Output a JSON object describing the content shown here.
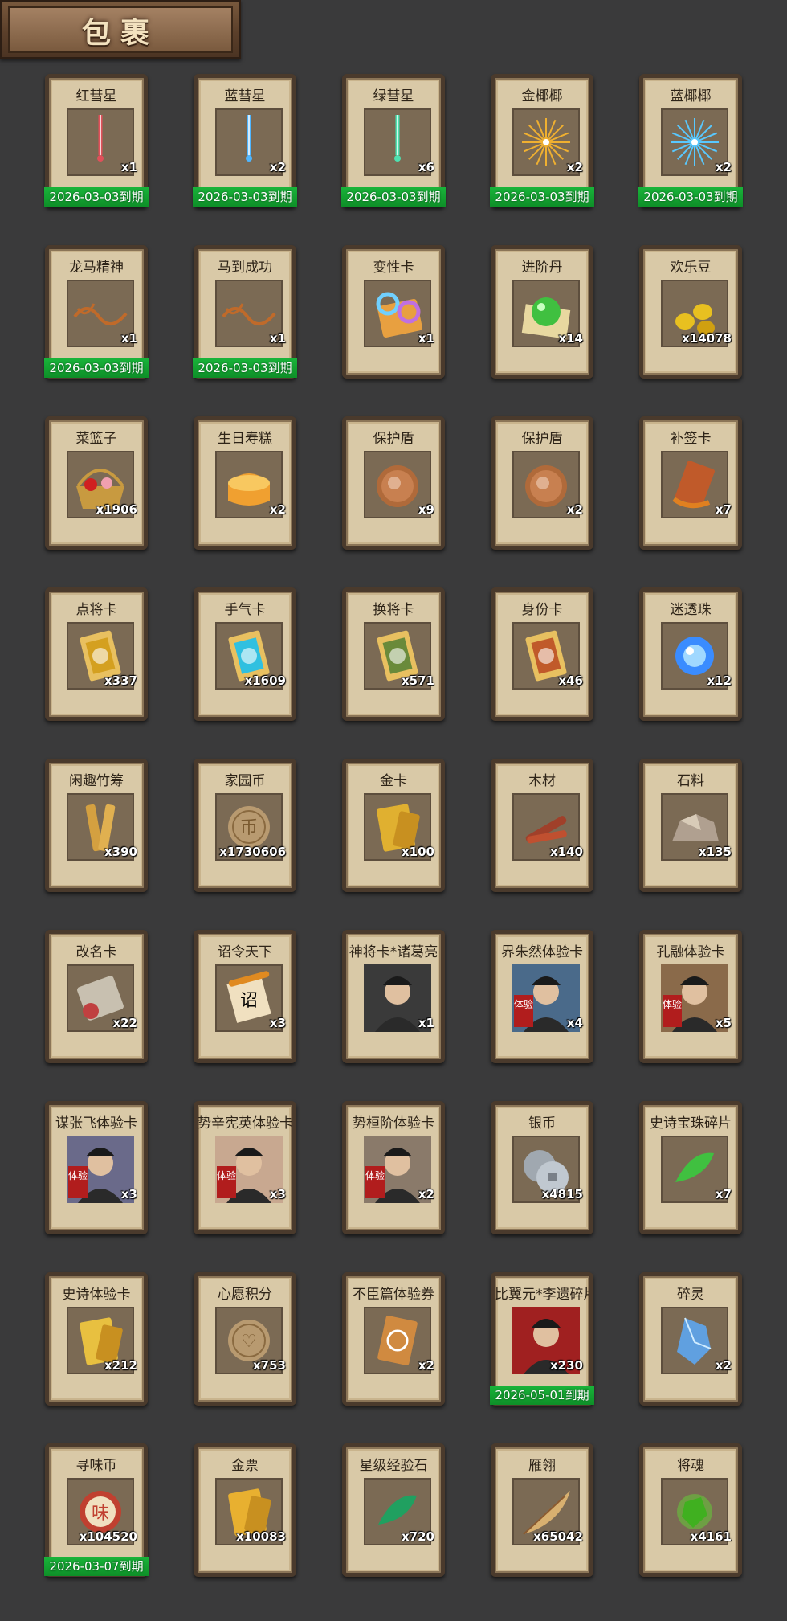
{
  "header": {
    "title": "包裹"
  },
  "items": [
    {
      "name": "红彗星",
      "qty": "x1",
      "expiry": "2026-03-03到期",
      "icon": "red-comet-icon",
      "color": "#e0505a"
    },
    {
      "name": "蓝彗星",
      "qty": "x2",
      "expiry": "2026-03-03到期",
      "icon": "blue-comet-icon",
      "color": "#4fb6ff"
    },
    {
      "name": "绿彗星",
      "qty": "x6",
      "expiry": "2026-03-03到期",
      "icon": "green-comet-icon",
      "color": "#4ee0b0"
    },
    {
      "name": "金椰椰",
      "qty": "x2",
      "expiry": "2026-03-03到期",
      "icon": "gold-firework-icon",
      "color": "#f0b030"
    },
    {
      "name": "蓝椰椰",
      "qty": "x2",
      "expiry": "2026-03-03到期",
      "icon": "blue-firework-icon",
      "color": "#58c8ff"
    },
    {
      "name": "龙马精神",
      "qty": "x1",
      "expiry": "2026-03-03到期",
      "icon": "calligraphy-icon",
      "color": "#c06a2a"
    },
    {
      "name": "马到成功",
      "qty": "x1",
      "expiry": "2026-03-03到期",
      "icon": "calligraphy-icon",
      "color": "#c06a2a"
    },
    {
      "name": "变性卡",
      "qty": "x1",
      "expiry": "",
      "icon": "gender-card-icon",
      "color": "#c070e0"
    },
    {
      "name": "进阶丹",
      "qty": "x14",
      "expiry": "",
      "icon": "green-pill-icon",
      "color": "#40c040"
    },
    {
      "name": "欢乐豆",
      "qty": "x14078",
      "expiry": "",
      "icon": "gold-beans-icon",
      "color": "#e8c020"
    },
    {
      "name": "菜篮子",
      "qty": "x1906",
      "expiry": "",
      "icon": "basket-icon",
      "color": "#c89a40"
    },
    {
      "name": "生日寿糕",
      "qty": "x2",
      "expiry": "",
      "icon": "cake-icon",
      "color": "#f0a030"
    },
    {
      "name": "保护盾",
      "qty": "x9",
      "expiry": "",
      "icon": "shield-icon",
      "color": "#b06a3a"
    },
    {
      "name": "保护盾",
      "qty": "x2",
      "expiry": "",
      "icon": "shield-icon",
      "color": "#b06a3a"
    },
    {
      "name": "补签卡",
      "qty": "x7",
      "expiry": "",
      "icon": "signin-card-icon",
      "color": "#c05a2a"
    },
    {
      "name": "点将卡",
      "qty": "x337",
      "expiry": "",
      "icon": "general-card-icon",
      "color": "#d4a020"
    },
    {
      "name": "手气卡",
      "qty": "x1609",
      "expiry": "",
      "icon": "luck-card-icon",
      "color": "#30c0e0"
    },
    {
      "name": "换将卡",
      "qty": "x571",
      "expiry": "",
      "icon": "swap-card-icon",
      "color": "#6a8a3a"
    },
    {
      "name": "身份卡",
      "qty": "x46",
      "expiry": "",
      "icon": "mask-card-icon",
      "color": "#c05a2a"
    },
    {
      "name": "迷透珠",
      "qty": "x12",
      "expiry": "",
      "icon": "blue-orb-icon",
      "color": "#3a8cff"
    },
    {
      "name": "闲趣竹筹",
      "qty": "x390",
      "expiry": "",
      "icon": "bamboo-token-icon",
      "color": "#d4a040"
    },
    {
      "name": "家园币",
      "qty": "x1730606",
      "expiry": "",
      "icon": "coin-icon",
      "color": "#b89a70"
    },
    {
      "name": "金卡",
      "qty": "x100",
      "expiry": "",
      "icon": "gold-card-icon",
      "color": "#e0b030"
    },
    {
      "name": "木材",
      "qty": "x140",
      "expiry": "",
      "icon": "wood-icon",
      "color": "#a0402a"
    },
    {
      "name": "石料",
      "qty": "x135",
      "expiry": "",
      "icon": "stone-icon",
      "color": "#b0a090"
    },
    {
      "name": "改名卡",
      "qty": "x22",
      "expiry": "",
      "icon": "rename-card-icon",
      "color": "#c04040"
    },
    {
      "name": "诏令天下",
      "qty": "x3",
      "expiry": "",
      "icon": "scroll-icon",
      "color": "#e08a20"
    },
    {
      "name": "神将卡*诸葛亮",
      "qty": "x1",
      "expiry": "",
      "icon": "portrait-icon",
      "color": "#3a3a3a"
    },
    {
      "name": "界朱然体验卡",
      "qty": "x4",
      "expiry": "",
      "icon": "portrait-icon",
      "color": "#4a6a8a",
      "tag": "体验"
    },
    {
      "name": "孔融体验卡",
      "qty": "x5",
      "expiry": "",
      "icon": "portrait-icon",
      "color": "#8a6a4a",
      "tag": "体验"
    },
    {
      "name": "谋张飞体验卡",
      "qty": "x3",
      "expiry": "",
      "icon": "portrait-icon",
      "color": "#6a6a8a",
      "tag": "体验"
    },
    {
      "name": "势辛宪英体验卡",
      "qty": "x3",
      "expiry": "",
      "icon": "portrait-icon",
      "color": "#c8a890",
      "tag": "体验"
    },
    {
      "name": "势桓阶体验卡",
      "qty": "x2",
      "expiry": "",
      "icon": "portrait-icon",
      "color": "#8a7a6a",
      "tag": "体验"
    },
    {
      "name": "银币",
      "qty": "x4815",
      "expiry": "",
      "icon": "silver-coin-icon",
      "color": "#a0a8b0"
    },
    {
      "name": "史诗宝珠碎片",
      "qty": "x7",
      "expiry": "",
      "icon": "green-shard-icon",
      "color": "#40c040"
    },
    {
      "name": "史诗体验卡",
      "qty": "x212",
      "expiry": "",
      "icon": "gold-card-icon",
      "color": "#e8c040"
    },
    {
      "name": "心愿积分",
      "qty": "x753",
      "expiry": "",
      "icon": "heart-coin-icon",
      "color": "#b89a70"
    },
    {
      "name": "不臣篇体验券",
      "qty": "x2",
      "expiry": "",
      "icon": "ticket-icon",
      "color": "#d08a40"
    },
    {
      "name": "比翼元*李遗碎片",
      "qty": "x230",
      "expiry": "2026-05-01到期",
      "icon": "portrait-icon",
      "color": "#a02020"
    },
    {
      "name": "碎灵",
      "qty": "x2",
      "expiry": "",
      "icon": "crystal-icon",
      "color": "#60a0e0"
    },
    {
      "name": "寻味币",
      "qty": "x104520",
      "expiry": "2026-03-07到期",
      "icon": "taste-coin-icon",
      "color": "#c04030"
    },
    {
      "name": "金票",
      "qty": "x10083",
      "expiry": "",
      "icon": "gold-ticket-icon",
      "color": "#e8b030"
    },
    {
      "name": "星级经验石",
      "qty": "x720",
      "expiry": "",
      "icon": "jade-icon",
      "color": "#20a060"
    },
    {
      "name": "雁翎",
      "qty": "x65042",
      "expiry": "",
      "icon": "feather-icon",
      "color": "#d8b070"
    },
    {
      "name": "将魂",
      "qty": "x4161",
      "expiry": "",
      "icon": "soul-icon",
      "color": "#60e030"
    }
  ]
}
